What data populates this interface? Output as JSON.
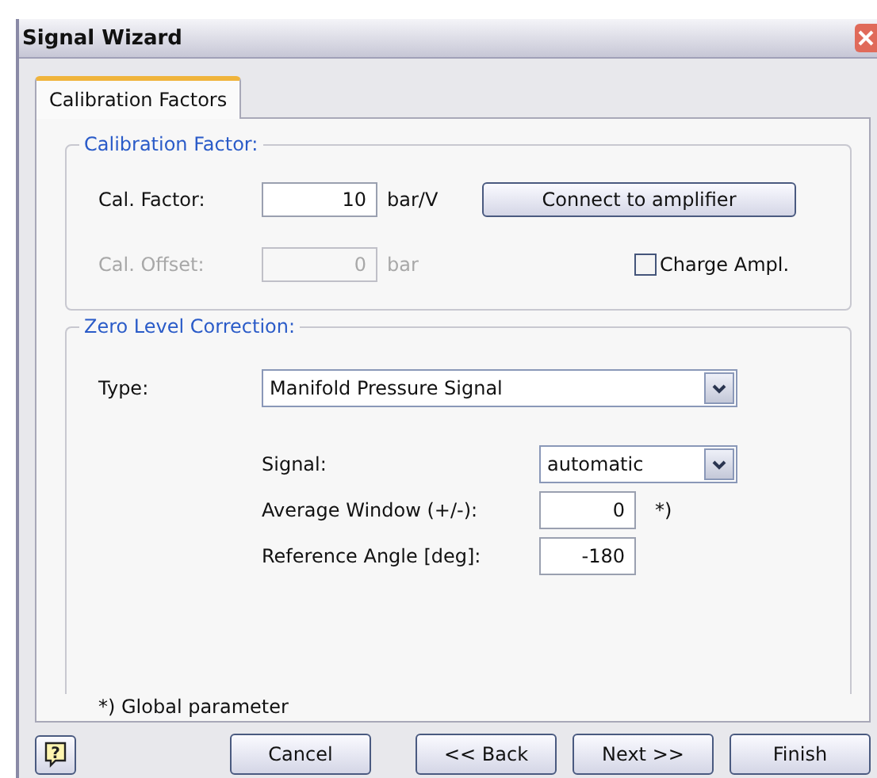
{
  "window": {
    "title": "Signal Wizard"
  },
  "tabs": [
    {
      "label": "Calibration Factors",
      "selected": true
    }
  ],
  "calibration_factor": {
    "title": "Calibration Factor:",
    "cal_factor": {
      "label": "Cal. Factor:",
      "value": "10",
      "unit": "bar/V",
      "disabled": false
    },
    "connect_button": "Connect to amplifier",
    "cal_offset": {
      "label": "Cal. Offset:",
      "value": "0",
      "unit": "bar",
      "disabled": true
    },
    "charge_ampl": {
      "label": "Charge Ampl.",
      "checked": false
    }
  },
  "zero_level_correction": {
    "title": "Zero Level Correction:",
    "type": {
      "label": "Type:",
      "value": "Manifold Pressure Signal"
    },
    "signal": {
      "label": "Signal:",
      "value": "automatic"
    },
    "average_window": {
      "label": "Average Window (+/-):",
      "value": "0",
      "note": "*)"
    },
    "reference_angle": {
      "label": "Reference Angle [deg]:",
      "value": "-180"
    },
    "footnote": "*) Global parameter"
  },
  "help_button": "?",
  "buttons": [
    "Cancel",
    "<< Back",
    "Next >>",
    "Finish"
  ]
}
